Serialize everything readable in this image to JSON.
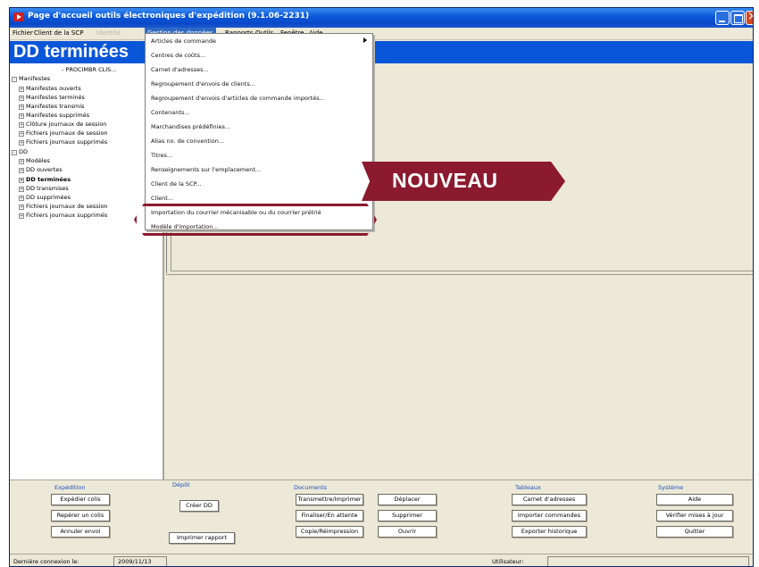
{
  "window": {
    "title": "Page d'accueil outils électroniques d'expédition (9.1.06-2231)",
    "controls": [
      "minimize-icon",
      "maximize-icon",
      "close-icon"
    ]
  },
  "menubar": {
    "items": [
      "Fichier",
      "Client de la SCP",
      "Identité",
      "Gestion des données",
      "Rapports",
      "Outils",
      "Fenêtre",
      "Aide"
    ]
  },
  "left_pane": {
    "header": "DD terminées",
    "subheader": "- PROCIMBR CLIS...",
    "tree": [
      {
        "label": "Manifestes",
        "expander": "-",
        "bold": false
      },
      {
        "label": "Manifestes ouverts",
        "expander": "+",
        "bold": false
      },
      {
        "label": "Manifestes terminés",
        "expander": "+",
        "bold": false
      },
      {
        "label": "Manifestes transmis",
        "expander": "+",
        "bold": false
      },
      {
        "label": "Manifestes supprimés",
        "expander": "+",
        "bold": false
      },
      {
        "label": "Clôture journaux de session",
        "expander": "+",
        "bold": false
      },
      {
        "label": "Fichiers journaux de session",
        "expander": "+",
        "bold": false
      },
      {
        "label": "Fichiers journaux supprimés",
        "expander": "+",
        "bold": false
      },
      {
        "label": "DD",
        "expander": "-",
        "bold": false
      },
      {
        "label": "Modèles",
        "expander": "+",
        "bold": false
      },
      {
        "label": "DD ouvertes",
        "expander": "+",
        "bold": false
      },
      {
        "label": "DD terminées",
        "expander": "+",
        "bold": true
      },
      {
        "label": "DD transmises",
        "expander": "+",
        "bold": false
      },
      {
        "label": "DD supprimées",
        "expander": "+",
        "bold": false
      },
      {
        "label": "Fichiers journaux de session",
        "expander": "+",
        "bold": false
      },
      {
        "label": "Fichiers journaux supprimés",
        "expander": "+",
        "bold": false
      }
    ]
  },
  "dropdown": {
    "items": [
      "Articles de commande",
      "Centres de coûts...",
      "Carnet d'adresses...",
      "Regroupement d'envois de clients...",
      "Regroupement d'envois d'articles de commande importés...",
      "Contenants...",
      "Marchandises prédéfinies...",
      "Alias no. de convention...",
      "Titres...",
      "Renseignements sur l'emplacement...",
      "Client de la SCP...",
      "Client...",
      "Importation du courrier mécanisable ou du courrier prétrié",
      "Modèle d'importation..."
    ]
  },
  "callout": {
    "label": "NOUVEAU",
    "color": "#8b1a2f"
  },
  "bottom_panel": {
    "groups": [
      {
        "title": "Expédition",
        "buttons": [
          "Expédier colis",
          "Repérer un colis",
          "Annuler envoi"
        ]
      },
      {
        "title": "Dépôt",
        "buttons": [
          "Créer DD",
          "Imprimer rapport"
        ]
      },
      {
        "title": "Documents",
        "buttons": [
          "Transmettre/Imprimer",
          "Déplacer",
          "Finaliser/En attente",
          "Supprimer",
          "Copie/Réimpression",
          "Ouvrir"
        ]
      },
      {
        "title": "Tableaux",
        "buttons": [
          "Carnet d'adresses",
          "Importer commandes",
          "Exporter historique"
        ]
      },
      {
        "title": "Système",
        "buttons": [
          "Aide",
          "Vérifier mises à jour",
          "Quitter"
        ]
      }
    ]
  },
  "statusbar": {
    "last_connection_label": "Dernière connexion le:",
    "last_connection_value": "2009/11/13",
    "user_label": "Utilisateur:",
    "user_value": ""
  },
  "colors": {
    "title_blue": "#0a56d8",
    "menu_highlight": "#316ac5",
    "accent_maroon": "#8b1a2f",
    "window_bg": "#ece9d8"
  }
}
